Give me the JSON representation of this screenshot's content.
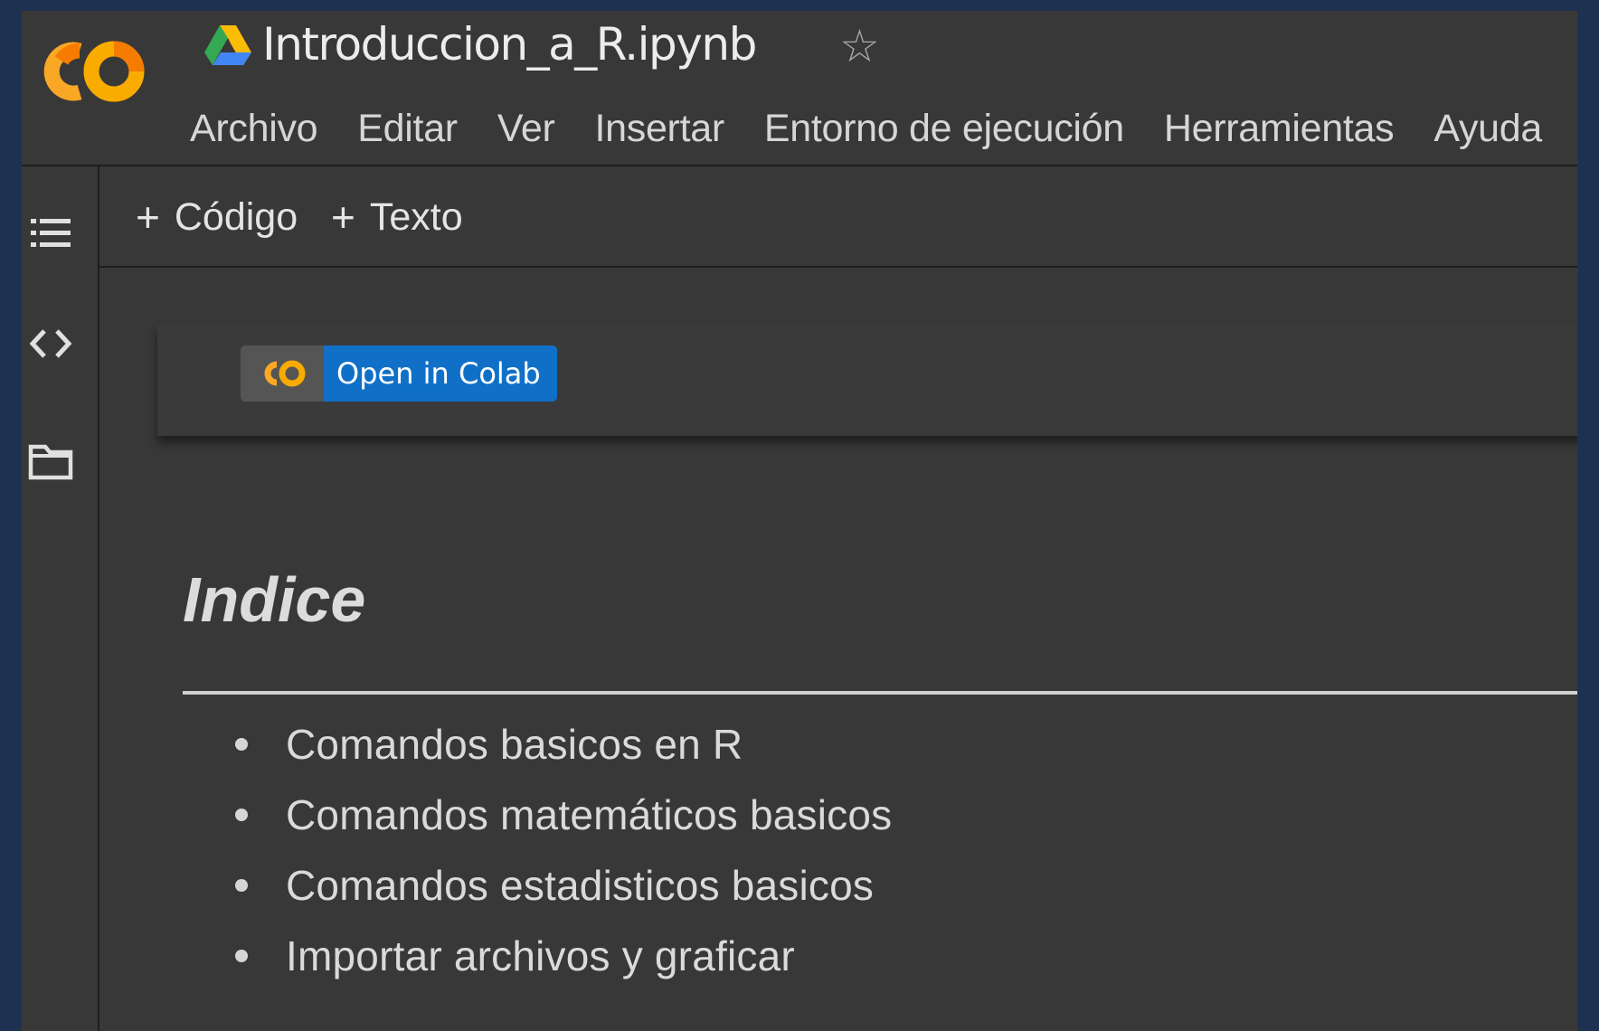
{
  "app": {
    "logo_text": "CO",
    "file_title": "Introduccion_a_R.ipynb",
    "star_icon": "star-outline-icon",
    "drive_icon": "google-drive-icon"
  },
  "menu": [
    {
      "label": "Archivo"
    },
    {
      "label": "Editar"
    },
    {
      "label": "Ver"
    },
    {
      "label": "Insertar"
    },
    {
      "label": "Entorno de ejecución"
    },
    {
      "label": "Herramientas"
    },
    {
      "label": "Ayuda"
    }
  ],
  "toolbar": {
    "code_label": "Código",
    "text_label": "Texto",
    "plus_glyph": "+"
  },
  "rail": {
    "icons": [
      "table-of-contents-icon",
      "code-snippets-icon",
      "files-folder-icon"
    ]
  },
  "notebook": {
    "badge": {
      "logo_text": "CO",
      "label": "Open in Colab"
    },
    "heading": "Indice",
    "items": [
      "Comandos basicos en R",
      "Comandos matemáticos basicos",
      "Comandos estadisticos basicos",
      "Importar archivos y graficar"
    ]
  },
  "colors": {
    "background": "#383838",
    "outer_border": "#1f3150",
    "colab_orange": "#f9a825",
    "colab_yellow": "#f9ab00",
    "badge_blue": "#1070c8"
  }
}
